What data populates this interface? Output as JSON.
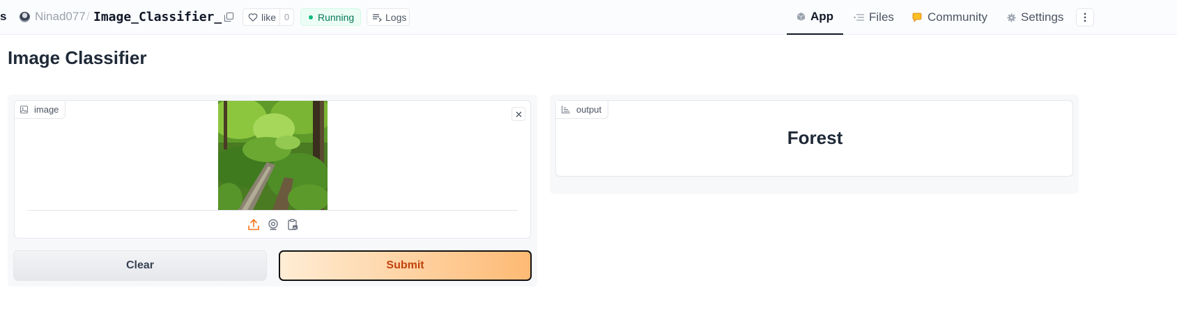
{
  "header": {
    "crumb_prefix": "s",
    "owner": "Ninad077",
    "separator": "/",
    "repo": "Image_Classifier_",
    "like_label": "like",
    "like_count": "0",
    "status": "Running",
    "logs_label": "Logs",
    "nav": {
      "app": "App",
      "files": "Files",
      "community": "Community",
      "settings": "Settings"
    }
  },
  "page": {
    "title": "Image Classifier"
  },
  "input": {
    "label": "image",
    "photo_alt": "forest path with fallen log and ferns"
  },
  "buttons": {
    "clear": "Clear",
    "submit": "Submit"
  },
  "output": {
    "label": "output",
    "value": "Forest"
  },
  "colors": {
    "accent": "#f97316",
    "running": "#10b981",
    "submit_gradient_start": "#ffedd5",
    "submit_gradient_end": "#fdba74"
  }
}
